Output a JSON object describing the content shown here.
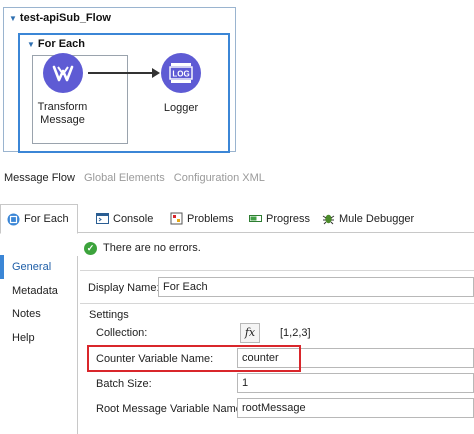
{
  "flow": {
    "title": "test-apiSub_Flow",
    "scope_title": "For Each",
    "nodes": [
      {
        "label_line1": "Transform",
        "label_line2": "Message",
        "icon": "dataweave-icon"
      },
      {
        "label": "Logger",
        "icon_text": "LOG",
        "icon": "logger-icon"
      }
    ]
  },
  "editor_tabs": [
    {
      "label": "Message Flow",
      "active": true
    },
    {
      "label": "Global Elements",
      "active": false
    },
    {
      "label": "Configuration XML",
      "active": false
    }
  ],
  "view_tabs": [
    {
      "label": "For Each",
      "icon": "foreach-icon",
      "active": true
    },
    {
      "label": "Console",
      "icon": "console-icon"
    },
    {
      "label": "Problems",
      "icon": "problems-icon"
    },
    {
      "label": "Progress",
      "icon": "progress-icon"
    },
    {
      "label": "Mule Debugger",
      "icon": "debugger-icon"
    }
  ],
  "status": {
    "text": "There are no errors.",
    "icon": "check-icon"
  },
  "sidebar": [
    "General",
    "Metadata",
    "Notes",
    "Help"
  ],
  "properties": {
    "display_name_label": "Display Name:",
    "display_name_value": "For Each",
    "settings_label": "Settings",
    "collection_label": "Collection:",
    "collection_fx": "fx",
    "collection_value": "[1,2,3]",
    "counter_label": "Counter Variable Name:",
    "counter_value": "counter",
    "batch_label": "Batch Size:",
    "batch_value": "1",
    "root_label": "Root Message Variable Name:",
    "root_value": "rootMessage"
  },
  "colors": {
    "accent": "#3b86d6",
    "node": "#5e5bd4",
    "highlight": "#d9262b",
    "ok": "#3ca33c"
  }
}
